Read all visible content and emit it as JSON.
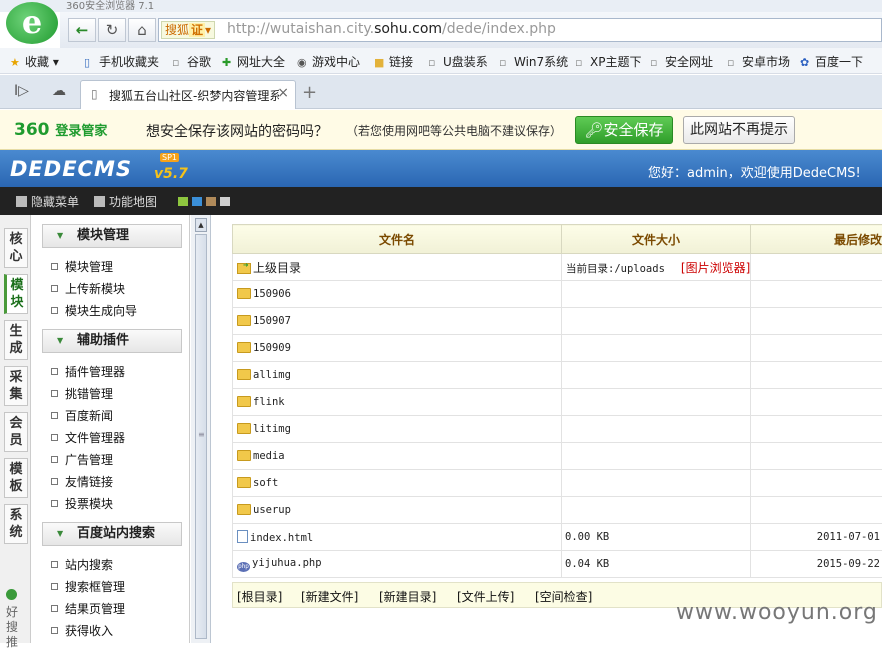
{
  "browser": {
    "window_title": "360安全浏览器 7.1",
    "logo_glyph": "e",
    "engine_label": "搜狐",
    "engine_badge": "证",
    "url_prefix": "http://wutaishan.city.",
    "url_domain": "sohu.com",
    "url_path": "/dede/index.php",
    "bookmarks": [
      "收藏",
      "手机收藏夹",
      "谷歌",
      "网址大全",
      "游戏中心",
      "链接",
      "U盘装系",
      "Win7系统",
      "XP主题下",
      "安全网址",
      "安卓市场",
      "百度一下"
    ],
    "tab_title": "搜狐五台山社区-织梦内容管理系统",
    "pw_bar": {
      "brand": "360",
      "brand_sub": "登录管家",
      "question": "想安全保存该网站的密码吗？",
      "note": "（若您使用网吧等公共电脑不建议保存）",
      "save_button": "安全保存",
      "noprompt_button": "此网站不再提示"
    }
  },
  "dede": {
    "logo": "DEDECMS",
    "version": "v5.7",
    "sp": "SP1",
    "welcome": "您好：admin，欢迎使用DedeCMS!",
    "toolbar": [
      "隐藏菜单",
      "功能地图"
    ],
    "theme_colors": [
      "#8ec63f",
      "#3b8fd8",
      "#b08a5a",
      "#cfcfcf"
    ]
  },
  "vtabs": [
    "核心",
    "模块",
    "生成",
    "采集",
    "会员",
    "模板",
    "系统"
  ],
  "vtabs_active": "模块",
  "vtab_footer": "好搜推",
  "menu": {
    "sections": [
      {
        "title": "模块管理",
        "items": [
          "模块管理",
          "上传新模块",
          "模块生成向导"
        ]
      },
      {
        "title": "辅助插件",
        "items": [
          "插件管理器",
          "挑错管理",
          "百度新闻",
          "文件管理器",
          "广告管理",
          "友情链接",
          "投票模块"
        ]
      },
      {
        "title": "百度站内搜索",
        "items": [
          "站内搜索",
          "搜索框管理",
          "结果页管理",
          "获得收入"
        ]
      }
    ]
  },
  "file_table": {
    "headers": [
      "文件名",
      "文件大小",
      "最后修改"
    ],
    "current_dir_label": "当前目录:/uploads",
    "image_browser_link": "[图片浏览器]",
    "parent_label": "上级目录",
    "folders": [
      "150906",
      "150907",
      "150909",
      "allimg",
      "flink",
      "litimg",
      "media",
      "soft",
      "userup"
    ],
    "files": [
      {
        "name": "index.html",
        "size": "0.00 KB",
        "date": "2011-07-01"
      },
      {
        "name": "yijuhua.php",
        "size": "0.04 KB",
        "date": "2015-09-22"
      }
    ]
  },
  "tool_links": [
    "[根目录]",
    "[新建文件]",
    "[新建目录]",
    "[文件上传]",
    "[空间检查]"
  ],
  "watermark": "www.wooyun.org"
}
